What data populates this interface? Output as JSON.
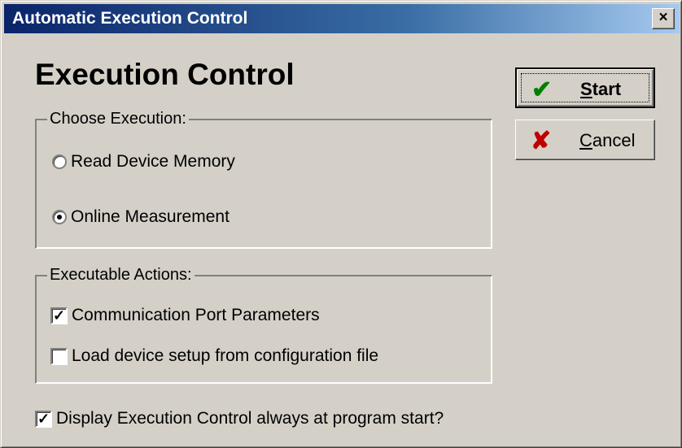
{
  "window": {
    "title": "Automatic Execution Control",
    "close_glyph": "×"
  },
  "heading": "Execution Control",
  "choose_group": {
    "label": "Choose Execution:",
    "options": [
      {
        "label": "Read Device Memory",
        "selected": false
      },
      {
        "label": "Online Measurement",
        "selected": true
      }
    ]
  },
  "actions_group": {
    "label": "Executable Actions:",
    "items": [
      {
        "label": "Communication Port Parameters",
        "checked": true
      },
      {
        "label": "Load device setup from configuration file",
        "checked": false
      }
    ]
  },
  "display_option": {
    "label": "Display Execution Control always at program start?",
    "checked": true
  },
  "buttons": {
    "start": {
      "label_u": "S",
      "label_rest": "tart",
      "icon": "check-icon",
      "icon_color": "#008000"
    },
    "cancel": {
      "label_u": "C",
      "label_rest": "ancel",
      "icon": "x-icon",
      "icon_color": "#c00000"
    }
  },
  "colors": {
    "face": "#d4d0c8",
    "title_start": "#0a246a",
    "title_end": "#a6caf0"
  }
}
